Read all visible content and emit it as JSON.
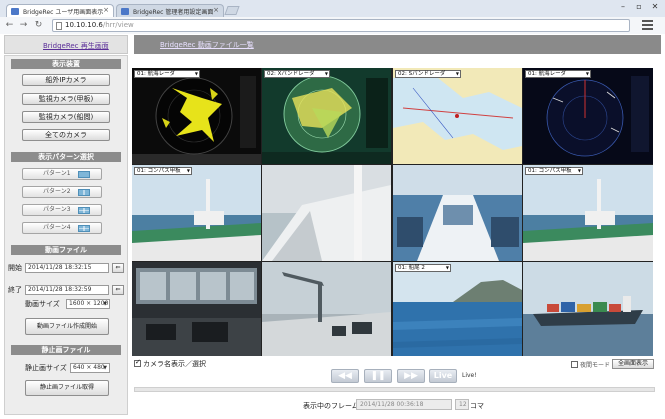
{
  "browser": {
    "tabs": [
      {
        "label": "BridgeRec ユーザ用画面表示",
        "active": true
      },
      {
        "label": "BridgeRec 管理者用設定画面",
        "active": false
      }
    ],
    "url_host": "10.10.10.6",
    "url_path": "/hrr/view"
  },
  "header": {
    "home_link": "BridgeRec 再生画面",
    "list_link": "BridgeRec 動画ファイル一覧"
  },
  "side": {
    "display_device": {
      "title": "表示装置",
      "buttons": [
        "船外IPカメラ",
        "監視カメラ(甲板)",
        "監視カメラ(船閲)",
        "全てのカメラ"
      ]
    },
    "pattern": {
      "title": "表示パターン選択",
      "buttons": [
        "パターン1",
        "パターン2",
        "パターン3",
        "パターン4"
      ]
    },
    "video_file": {
      "title": "動画ファイル",
      "start_label": "開始",
      "start_value": "2014/11/28 18:32:15",
      "end_label": "終了",
      "end_value": "2014/11/28 18:32:59",
      "size_label": "動画サイズ",
      "size_value": "1600 × 1200",
      "get_button": "動画ファイル作成開始"
    },
    "still_file": {
      "title": "静止画ファイル",
      "size_label": "静止画サイズ",
      "size_value": "640 × 480",
      "get_button": "静止画ファイル取得"
    }
  },
  "cameras": [
    {
      "label": "01: 航海レーダ",
      "selector": true
    },
    {
      "label": "02: Xバンドレーダ",
      "selector": true
    },
    {
      "label": "02: Sバンドレーダ",
      "selector": true
    },
    {
      "label": "01: 航海レーダ",
      "selector": true
    },
    {
      "label": "01: コンパス甲板",
      "selector": true
    },
    {
      "label": "",
      "selector": false
    },
    {
      "label": "",
      "selector": false
    },
    {
      "label": "01: コンパス甲板",
      "selector": true
    },
    {
      "label": "",
      "selector": false
    },
    {
      "label": "",
      "selector": false
    },
    {
      "label": "01: 船尾 2",
      "selector": true
    },
    {
      "label": "",
      "selector": false
    }
  ],
  "controls": {
    "camera_name_toggle": "カメラ名表示／選択",
    "night_mode": "夜間モード",
    "fullscreen": "全画面表示",
    "rewind": "◀◀",
    "pause": "❚❚",
    "forward": "▶▶",
    "live": "Live",
    "live_indicator": "Live!",
    "frame_label": "表示中のフレーム",
    "frame_time": "2014/11/28 00:36:18",
    "frame_count": "12",
    "frame_unit": "コマ"
  }
}
